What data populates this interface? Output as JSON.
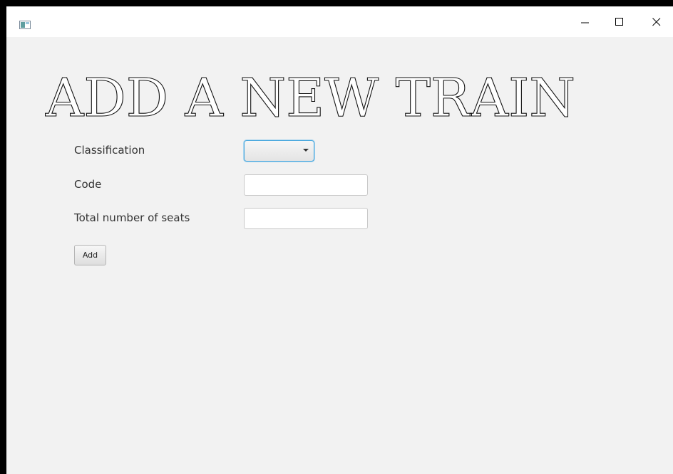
{
  "window": {
    "minimize_icon": "minimize-icon",
    "maximize_icon": "maximize-icon",
    "close_icon": "close-icon",
    "app_icon": "app-window-icon"
  },
  "heading": {
    "title": "ADD A NEW TRAIN"
  },
  "form": {
    "classification_label": "Classification",
    "classification_value": "",
    "code_label": "Code",
    "code_value": "",
    "seats_label": "Total number of seats",
    "seats_value": "",
    "add_label": "Add"
  },
  "colors": {
    "background": "#f2f2f2",
    "titlebar": "#ffffff",
    "focus_accent": "#47a7dd"
  }
}
